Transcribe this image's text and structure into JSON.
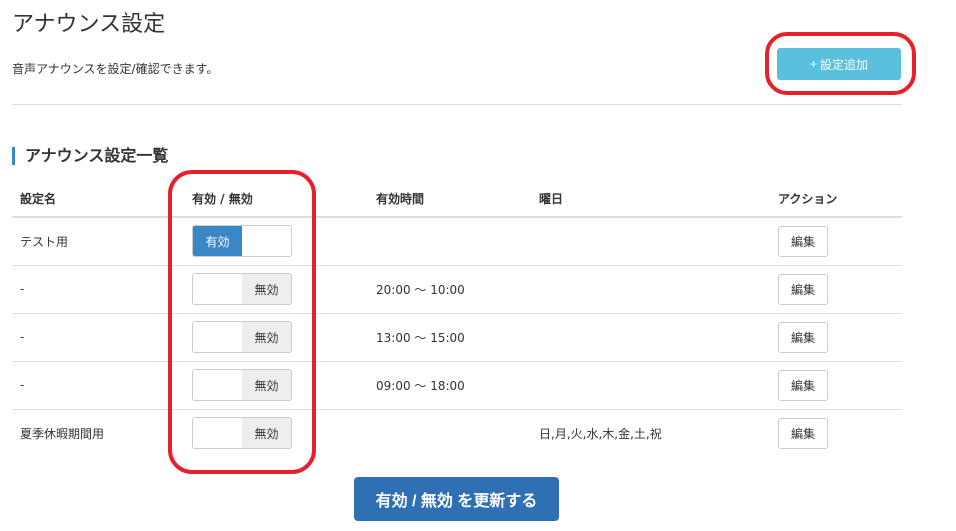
{
  "page": {
    "title": "アナウンス設定",
    "description": "音声アナウンスを設定/確認できます。"
  },
  "add_button": {
    "icon": "plus-icon",
    "label": "設定追加"
  },
  "list": {
    "title": "アナウンス設定一覧",
    "headers": [
      "設定名",
      "有効 / 無効",
      "有効時間",
      "曜日",
      "アクション"
    ],
    "rows": [
      {
        "name": "テスト用",
        "enabled": true,
        "toggle_label": "有効",
        "time": "",
        "days": "",
        "action": "編集"
      },
      {
        "name": "-",
        "enabled": false,
        "toggle_label": "無効",
        "time": "20:00 〜 10:00",
        "days": "",
        "action": "編集"
      },
      {
        "name": "-",
        "enabled": false,
        "toggle_label": "無効",
        "time": "13:00 〜 15:00",
        "days": "",
        "action": "編集"
      },
      {
        "name": "-",
        "enabled": false,
        "toggle_label": "無効",
        "time": "09:00 〜 18:00",
        "days": "",
        "action": "編集"
      },
      {
        "name": "夏季休暇期間用",
        "enabled": false,
        "toggle_label": "無効",
        "time": "",
        "days": "日,月,火,水,木,金,土,祝",
        "action": "編集"
      }
    ]
  },
  "update_button": {
    "label": "有効 / 無効 を更新する"
  },
  "colors": {
    "add_button": "#5bc0de",
    "toggle_active": "#3a87c8",
    "update_button": "#2f6fb3",
    "highlight": "#e8202a"
  }
}
